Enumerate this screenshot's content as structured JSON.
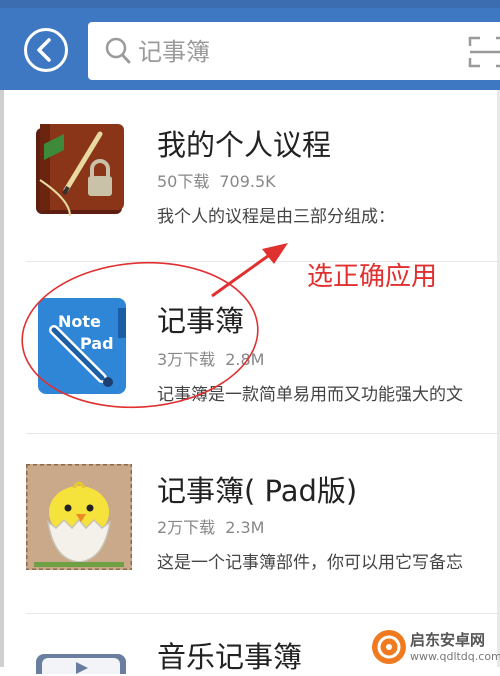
{
  "header": {
    "search_placeholder": "记事簿"
  },
  "apps": [
    {
      "title": "我的个人议程",
      "downloads": "50下载",
      "size": "709.5K",
      "desc": "我个人的议程是由三部分组成："
    },
    {
      "title": "记事簿",
      "downloads": "3万下载",
      "size": "2.8M",
      "desc": "记事簿是一款简单易用而又功能强大的文",
      "icon_text_1": "Note",
      "icon_text_2": "Pad"
    },
    {
      "title": "记事簿( Pad版)",
      "downloads": "2万下载",
      "size": "2.3M",
      "desc": "这是一个记事簿部件，你可以用它写备忘"
    },
    {
      "title": "音乐记事簿"
    }
  ],
  "annotation": {
    "label": "选正确应用",
    "color": "#e03030"
  },
  "watermark": {
    "name": "启东安卓网",
    "url": "www.qdltdq.com"
  },
  "colors": {
    "header": "#3f78c2",
    "accent_red": "#e03030"
  }
}
